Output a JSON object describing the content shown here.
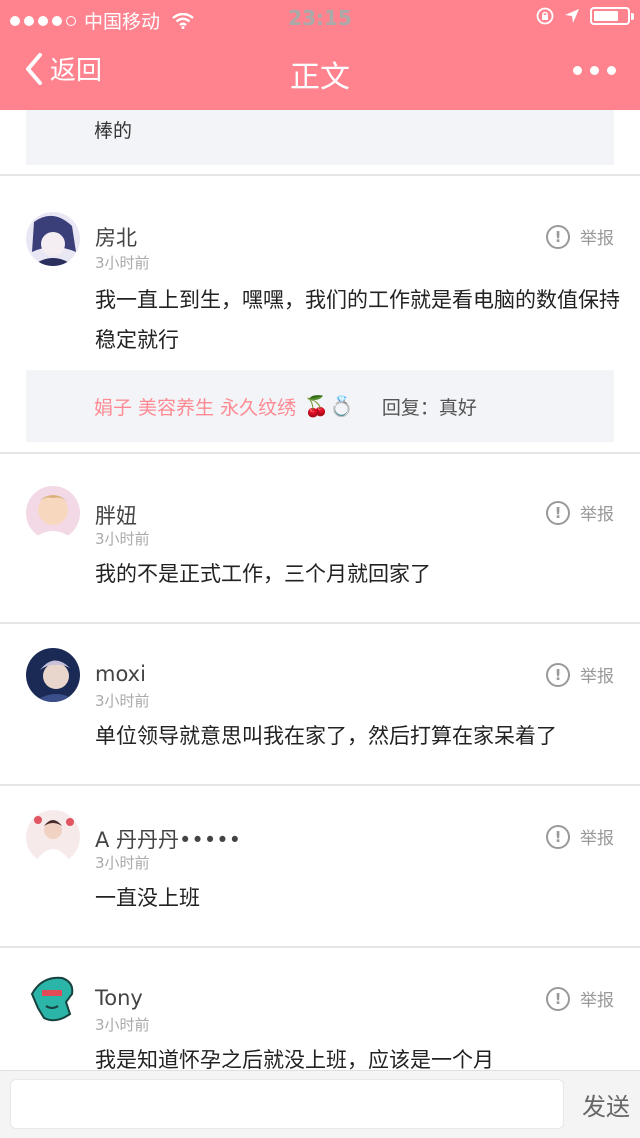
{
  "status_bar": {
    "carrier": "中国移动",
    "time": "23:15"
  },
  "navbar": {
    "back_label": "返回",
    "title": "正文"
  },
  "top_reply": {
    "text": "棒的"
  },
  "comments": [
    {
      "name": "房北",
      "time": "3小时前",
      "text": "我一直上到生，嘿嘿，我们的工作就是看电脑的数值保持稳定就行",
      "report_label": "举报",
      "reply": {
        "name": "娟子 美容养生 永久纹绣",
        "emoji": "🍒💍",
        "label": "回复：",
        "content": "真好"
      }
    },
    {
      "name": "胖妞",
      "time": "3小时前",
      "text": "我的不是正式工作，三个月就回家了",
      "report_label": "举报"
    },
    {
      "name": "moxi",
      "time": "3小时前",
      "text": "单位领导就意思叫我在家了，然后打算在家呆着了",
      "report_label": "举报"
    },
    {
      "name": "A 丹丹丹•••••",
      "time": "3小时前",
      "text": "一直没上班",
      "report_label": "举报"
    },
    {
      "name": "Tony",
      "time": "3小时前",
      "text": "我是知道怀孕之后就没上班，应该是一个月",
      "report_label": "举报"
    }
  ],
  "bottom_bar": {
    "input_placeholder": "",
    "send_label": "发送"
  },
  "colors": {
    "header": "#ff838f",
    "reply_name": "#ff8a93"
  }
}
